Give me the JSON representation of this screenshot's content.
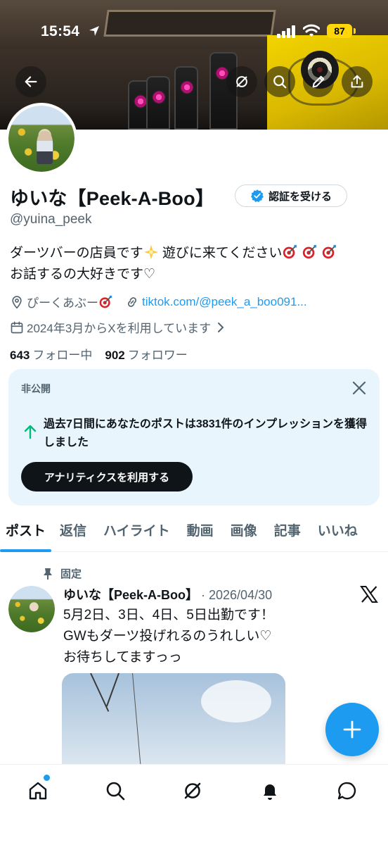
{
  "status_bar": {
    "time": "15:54",
    "battery": "87"
  },
  "banner_actions": {
    "back": "arrow-left-icon",
    "grok": "grok-icon",
    "search": "search-icon",
    "edit": "pencil-icon",
    "share": "share-icon"
  },
  "profile": {
    "display_name": "ゆいな【Peek-A-Boo】",
    "verify_button": "認証を受ける",
    "handle": "@yuina_peek",
    "bio_line1": "ダーツバーの店員です",
    "bio_line1b": " 遊びに来てください",
    "bio_line2": "お話するの大好きです♡",
    "location": "ぴーくあぶー",
    "link": "tiktok.com/@peek_a_boo091...",
    "joined": "2024年3月からXを利用しています",
    "following_count": "643",
    "following_label": "フォロー中",
    "followers_count": "902",
    "followers_label": "フォロワー"
  },
  "analytics_card": {
    "label": "非公開",
    "message": "過去7日間にあなたのポストは3831件のインプレッションを獲得しました",
    "button": "アナリティクスを利用する"
  },
  "tabs": [
    {
      "label": "ポスト"
    },
    {
      "label": "返信"
    },
    {
      "label": "ハイライト"
    },
    {
      "label": "動画"
    },
    {
      "label": "画像"
    },
    {
      "label": "記事"
    },
    {
      "label": "いいね"
    }
  ],
  "pinned_post": {
    "pinned_label": "固定",
    "author": "ゆいな【Peek-A-Boo】",
    "date": "· 2026/04/30",
    "line1": "5月2日、3日、4日、5日出勤です！",
    "line2": "GWもダーツ投げれるのうれしい♡",
    "line3": "お待ちしてますっっ"
  },
  "bottom_nav": [
    "home-icon",
    "search-icon",
    "grok-icon",
    "notifications-icon",
    "messages-icon"
  ],
  "colors": {
    "accent": "#1d9bf0",
    "text": "#0f1419",
    "muted": "#536471",
    "card_bg": "#e8f5fd"
  }
}
